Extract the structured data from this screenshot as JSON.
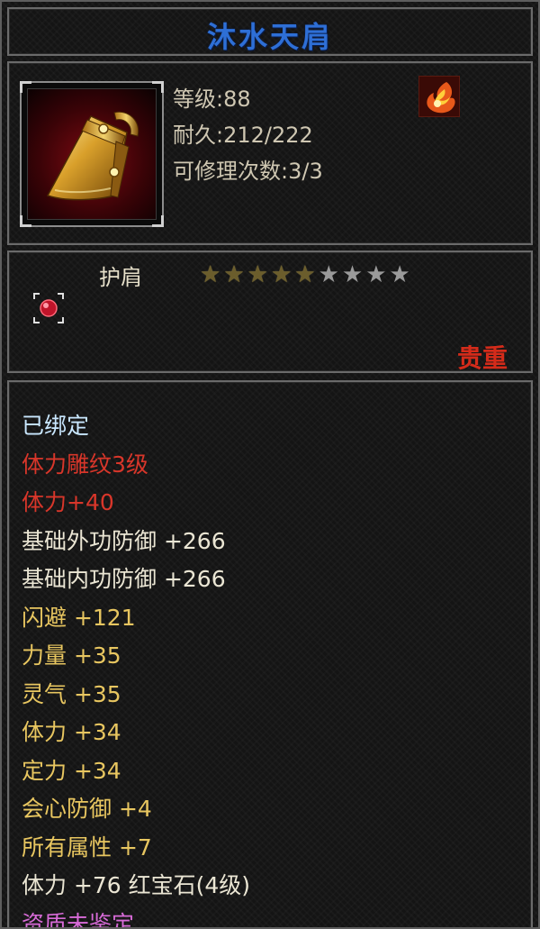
{
  "item": {
    "name": "沐水天肩",
    "level": "等级:88",
    "durability": "耐久:212/222",
    "repair_count": "可修理次数:3/3",
    "type": "护肩",
    "stars_total": 9,
    "stars_filled": 5,
    "rarity": "贵重"
  },
  "attributes": [
    {
      "text": "已绑定",
      "color": "bound"
    },
    {
      "text": "体力雕纹3级",
      "color": "red"
    },
    {
      "text": "体力+40",
      "color": "red"
    },
    {
      "text": "基础外功防御 +266",
      "color": "white"
    },
    {
      "text": "基础内功防御 +266",
      "color": "white"
    },
    {
      "text": "闪避 +121",
      "color": "yellow"
    },
    {
      "text": "力量 +35",
      "color": "yellow"
    },
    {
      "text": "灵气 +35",
      "color": "yellow"
    },
    {
      "text": "体力 +34",
      "color": "yellow"
    },
    {
      "text": "定力 +34",
      "color": "yellow"
    },
    {
      "text": "会心防御 +4",
      "color": "yellow"
    },
    {
      "text": "所有属性 +7",
      "color": "yellow"
    },
    {
      "text": "体力 +76 红宝石(4级)",
      "color": "white"
    },
    {
      "text": "资质未鉴定",
      "color": "purple"
    }
  ],
  "colors": {
    "title": "#2e6fd6",
    "bound": "#c9e7ff",
    "red": "#d8362a",
    "white": "#ebe6d4",
    "yellow": "#e8c660",
    "purple": "#d86bd8",
    "rarity": "#d42b1a"
  },
  "icons": {
    "item": "shoulder-pad-icon",
    "element": "fire-element-icon",
    "gem": "ruby-socket-icon"
  }
}
